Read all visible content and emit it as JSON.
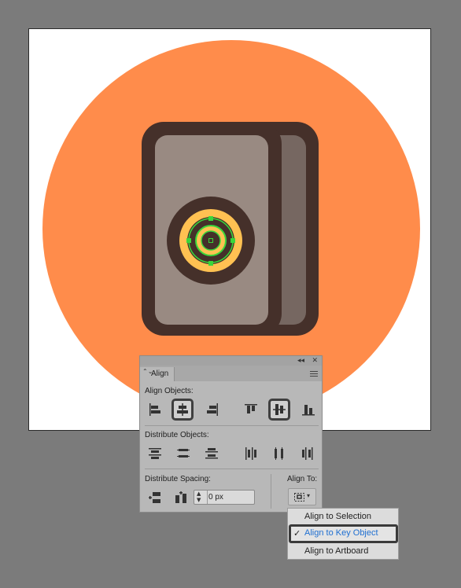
{
  "panel": {
    "title": "Align",
    "sections": {
      "align_objects": "Align Objects:",
      "distribute_objects": "Distribute Objects:",
      "distribute_spacing": "Distribute Spacing:",
      "align_to": "Align To:"
    },
    "spacing_value": "0 px",
    "controls": {
      "collapse": "◂◂",
      "close": "✕",
      "tab_arrows": "⌃⌄",
      "stepper_up": "▲",
      "stepper_down": "▼",
      "chevron": "▾"
    }
  },
  "align_to_menu": {
    "items": [
      {
        "label": "Align to Selection",
        "checked": false
      },
      {
        "label": "Align to Key Object",
        "checked": true
      },
      {
        "label": "Align to Artboard",
        "checked": false
      }
    ],
    "checkmark": "✓"
  },
  "colors": {
    "canvas_bg": "#7b7b7b",
    "artboard": "#ffffff",
    "circle_bg": "#ff8c4b",
    "outline": "#45302a",
    "door_front": "#998a82",
    "door_back": "#766761",
    "lock_ring": "#ffc152",
    "lock_inner": "#45302a",
    "selection": "#3ad63a",
    "highlight_text": "#1f6fd1"
  }
}
